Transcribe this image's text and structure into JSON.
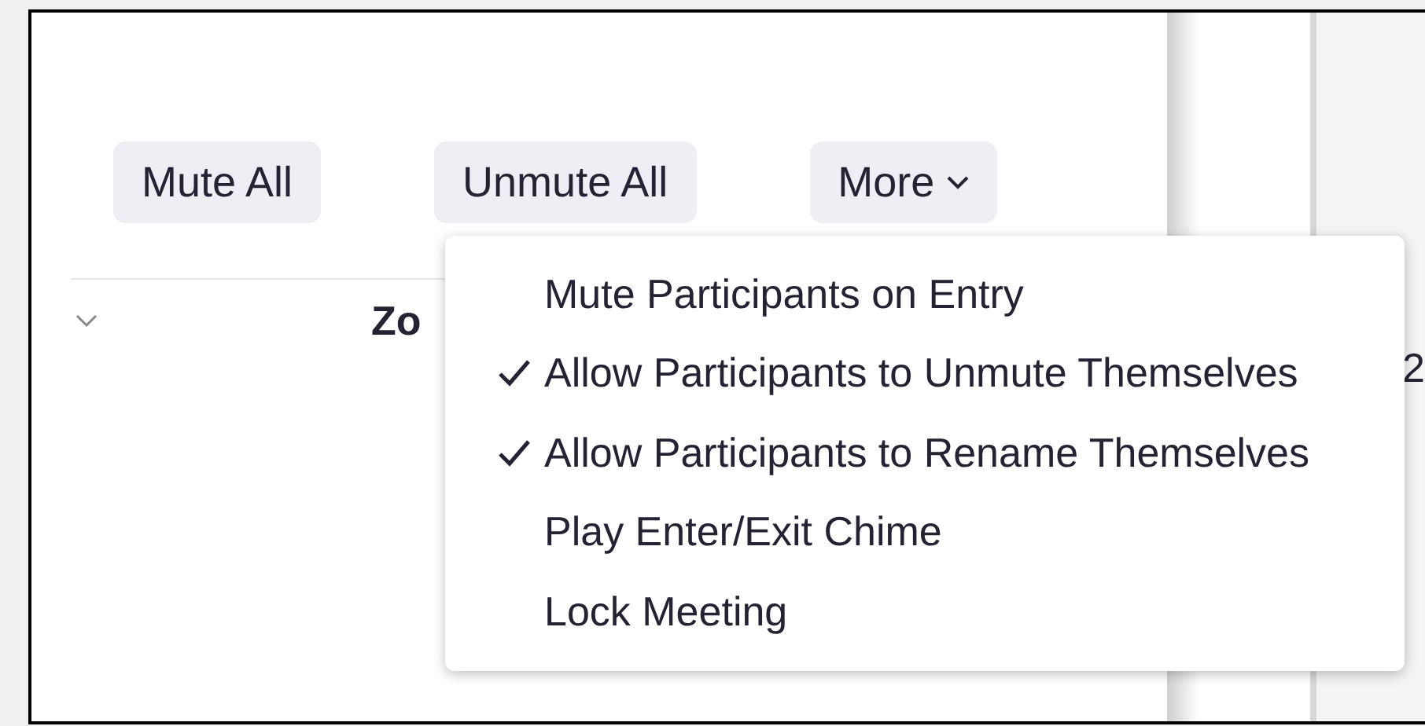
{
  "buttons": [
    {
      "label": "Mute All"
    },
    {
      "label": "Unmute All"
    },
    {
      "label": "More",
      "dropdown": true
    }
  ],
  "group_header": {
    "label": "Zo"
  },
  "side_text": "2",
  "menu": {
    "items": [
      {
        "label": "Mute Participants on Entry",
        "checked": false
      },
      {
        "label": "Allow Participants to Unmute Themselves",
        "checked": true
      },
      {
        "label": "Allow Participants to Rename Themselves",
        "checked": true
      },
      {
        "label": "Play Enter/Exit Chime",
        "checked": false
      },
      {
        "label": "Lock Meeting",
        "checked": false
      }
    ]
  }
}
